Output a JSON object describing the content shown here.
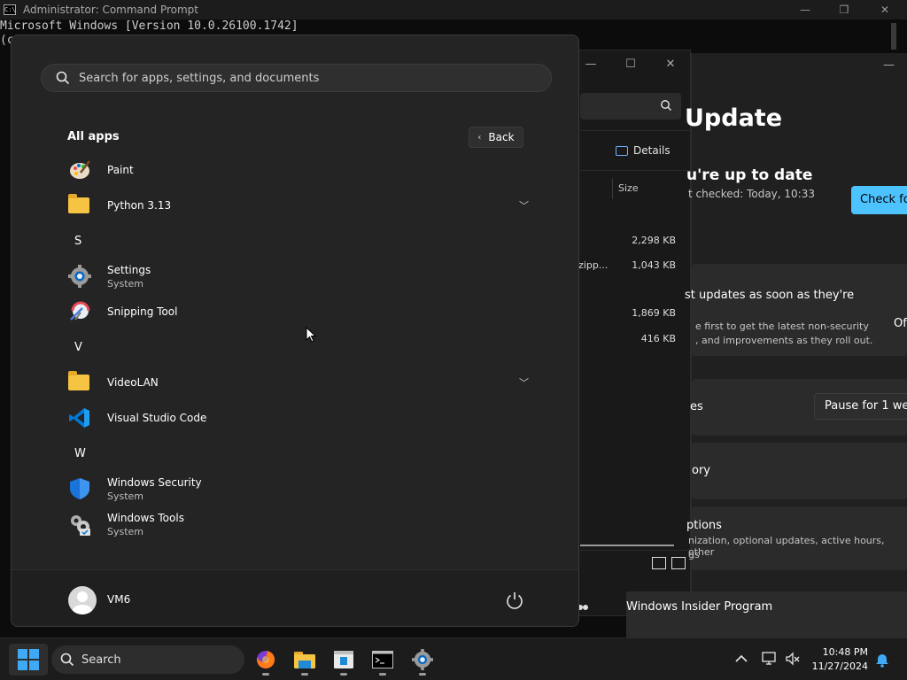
{
  "cmd": {
    "title": "Administrator: Command Prompt",
    "lines": [
      "Microsoft Windows [Version 10.0.26100.1742]",
      "(c"
    ],
    "icon": "cmd-icon",
    "controls": {
      "minimize": "—",
      "restore": "❐",
      "close": "✕"
    }
  },
  "explorer": {
    "details_label": "Details",
    "size_header": "Size",
    "sizes": [
      "2,298 KB",
      "1,043 KB",
      "1,869 KB",
      "416 KB"
    ],
    "name_fragment": "zipp...",
    "controls": {
      "minimize": "—",
      "maximize": "☐",
      "close": "✕"
    }
  },
  "settings": {
    "title": "Update",
    "status_title": "u're up to date",
    "last_checked": "t checked: Today, 10:33",
    "check_button": "Check fo",
    "latest_title": "st updates as soon as they're",
    "latest_desc_1": "e first to get the latest non-security",
    "latest_desc_2": ", and improvements as they roll out.",
    "latest_toggle": "Of",
    "pause_label": "es",
    "pause_button": "Pause for 1 wee",
    "history_label": "ory",
    "advanced_title": "ptions",
    "advanced_desc_1": "nization, optional updates, active hours, other",
    "advanced_desc_2": "gs",
    "insider": "Windows Insider Program",
    "minimize": "—"
  },
  "start": {
    "search_placeholder": "Search for apps, settings, and documents",
    "all_apps_title": "All apps",
    "back_label": "Back",
    "apps": [
      {
        "name": "Paint",
        "sub": ""
      },
      {
        "name": "Python 3.13",
        "sub": ""
      },
      {
        "name": "Settings",
        "sub": "System"
      },
      {
        "name": "Snipping Tool",
        "sub": ""
      },
      {
        "name": "VideoLAN",
        "sub": ""
      },
      {
        "name": "Visual Studio Code",
        "sub": ""
      },
      {
        "name": "Windows Security",
        "sub": "System"
      },
      {
        "name": "Windows Tools",
        "sub": "System"
      }
    ],
    "letters": [
      "S",
      "V",
      "W"
    ],
    "user_name": "VM6"
  },
  "taskbar": {
    "search_label": "Search",
    "time": "10:48 PM",
    "date": "11/27/2024"
  },
  "colors": {
    "accent": "#4cc2ff",
    "start_bg": "#242424",
    "taskbar_bg": "#1c1c1c"
  }
}
